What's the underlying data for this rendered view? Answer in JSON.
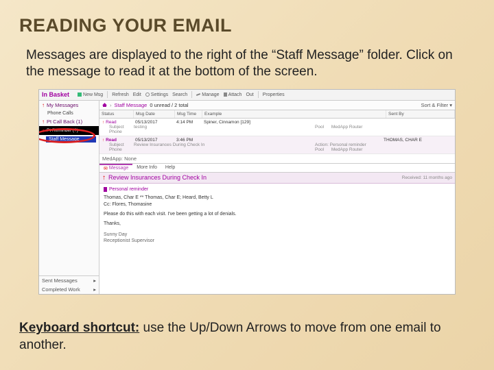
{
  "slide": {
    "title": "READING YOUR EMAIL",
    "paragraph": "Messages are displayed to the right of the “Staff Message” folder. Click on the message to read it at the bottom of the screen.",
    "footer_label": "Keyboard shortcut:",
    "footer_text": " use the Up/Down Arrows to move from one email to another."
  },
  "app": {
    "title": "In Basket",
    "toolbar": {
      "new": "New Msg",
      "refresh": "Refresh",
      "edit": "Edit",
      "settings": "Settings",
      "search": "Search",
      "manage": "Manage",
      "attach": "Attach",
      "out": "Out",
      "properties": "Properties"
    },
    "sidebar": {
      "my_messages": "My Messages",
      "sub1": "Phone Calls",
      "callback": "Pt Call Back (1)",
      "reminder": "Pt Reminder (?)",
      "staff_message": "Staff Message",
      "sent": "Sent Messages",
      "completed": "Completed Work"
    },
    "breadcrumb": {
      "current": "Staff Message",
      "meta": "0 unread / 2 total",
      "sort": "Sort & Filter"
    },
    "columns": {
      "status": "Status",
      "date": "Msg Date",
      "time": "Msg Time",
      "desc": "Example",
      "sent": "Sent By"
    },
    "rows": [
      {
        "status": "Read",
        "date": "05/13/2017",
        "time": "4:14 PM",
        "patient": "Spiner, Cinnamon [129]",
        "sent": "",
        "subject_label": "Subject",
        "subject": "testing",
        "phone_label": "Phone",
        "pool_label": "Pool",
        "action_label": "MedApp Router"
      },
      {
        "status": "Read",
        "date": "05/13/2017",
        "time": "3:46 PM",
        "patient": "",
        "sent": "THOMAS, CHAR E",
        "subject_label": "Subject",
        "subject": "Review Insurances During Check In",
        "phone_label": "Phone",
        "pool_label": "Pool",
        "action_label": "MedApp Router",
        "action2": "Action: Personal reminder"
      }
    ],
    "attach_bar": "MedApp: None",
    "detail_tabs": {
      "message": "Message",
      "more": "More Info",
      "help": "Help"
    },
    "detail": {
      "title": "Review Insurances During Check In",
      "received": "Received: 11 months ago",
      "flag": "Personal reminder",
      "to": "Thomas, Char E ** Thomas, Char E; Heard, Betty L",
      "cc": "Cc: Flores, Thomasine",
      "body": "Please do this with each visit. I've been getting a lot of denials.",
      "thanks": "Thanks,",
      "sig1": "Sunny Day",
      "sig2": "Receptionist Supervisor"
    }
  }
}
